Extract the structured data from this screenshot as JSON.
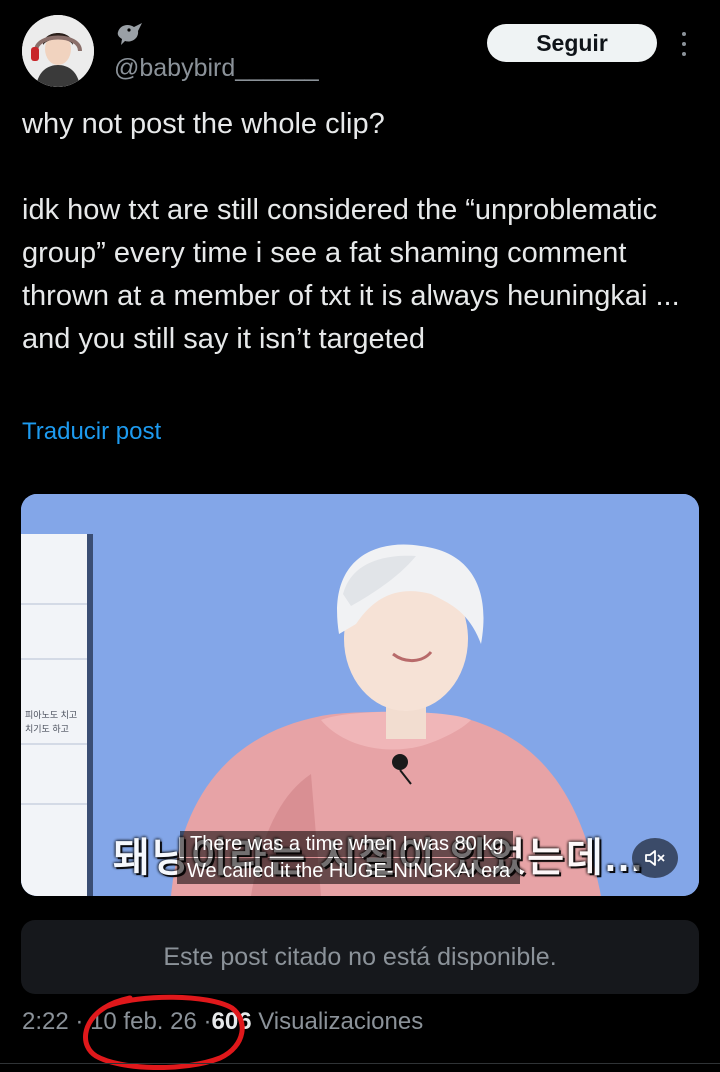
{
  "user": {
    "handle": "@babybird______",
    "avatar_icon": "avatar-photo",
    "name_icon": "bird-emoji-icon"
  },
  "header": {
    "follow_label": "Seguir",
    "more_icon": "more-vertical-icon"
  },
  "tweet": {
    "text": "why not post the whole clip?\n\nidk how txt are still considered the “unproblematic group” every time i see a fat shaming comment thrown at a member of txt it is always heuningkai ... and you still say it isn’t targeted",
    "translate_label": "Traducir post"
  },
  "media": {
    "korean_subtitle": "돼닝이라는 시절이 있었는데...",
    "subtitle_line_1": "There was a time when I was 80 kg",
    "subtitle_line_2": "We called it the HUGE-NINGKAI era",
    "sign_text_1": "피아노도 치고",
    "sign_text_2": "치기도 하고",
    "mute_icon": "speaker-muted-icon"
  },
  "quoted_post": {
    "text": "Este post citado no está disponible."
  },
  "meta": {
    "time": "2:22",
    "separator": "·",
    "date": "10 feb. 26",
    "views_count": "606",
    "views_label": "Visualizaciones"
  },
  "colors": {
    "background": "#000000",
    "text": "#e7e9ea",
    "muted": "#8b9299",
    "link": "#1d9bf0",
    "annotation": "#e0181b"
  }
}
